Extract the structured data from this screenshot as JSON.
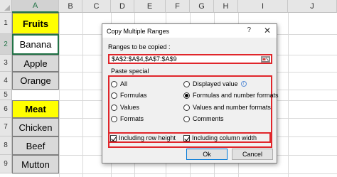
{
  "sheet": {
    "columns": [
      "A",
      "B",
      "C",
      "D",
      "E",
      "F",
      "G",
      "H",
      "I",
      "J"
    ],
    "rows": [
      "1",
      "2",
      "3",
      "4",
      "5",
      "6",
      "7",
      "8",
      "9"
    ],
    "cells": [
      "Fruits",
      "Banana",
      "Apple",
      "Orange",
      "",
      "Meat",
      "Chicken",
      "Beef",
      "Mutton"
    ]
  },
  "dialog": {
    "title": "Copy Multiple Ranges",
    "help": "?",
    "close": "✕",
    "ranges_label": "Ranges to be copied :",
    "ranges_value": "$A$2:$A$4,$A$7:$A$9",
    "paste_special_label": "Paste special",
    "options": {
      "all": "All",
      "displayed_value": "Displayed value",
      "formulas": "Formulas",
      "formulas_and_number_formats": "Formulas and number formats",
      "values": "Values",
      "values_and_number_formats": "Values and number formats",
      "formats": "Formats",
      "comments": "Comments"
    },
    "selected_option": "formulas_and_number_formats",
    "info_icon_glyph": "i",
    "including_row_height": "Including row height",
    "including_column_width": "Including column width",
    "ok": "Ok",
    "cancel": "Cancel"
  },
  "colors": {
    "highlight": "#e0262b",
    "header_fill": "#ffff00",
    "gray_fill": "#d9d9d9",
    "excel_green": "#217346"
  }
}
